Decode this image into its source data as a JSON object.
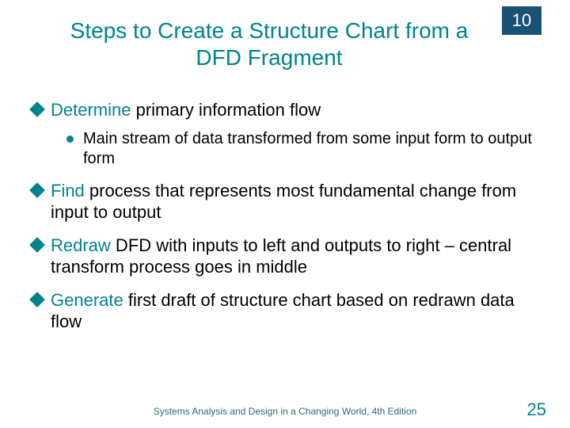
{
  "chapter": "10",
  "title": "Steps to Create a Structure Chart from a DFD Fragment",
  "bullets": [
    {
      "lead": "Determine",
      "rest": " primary information flow",
      "sub": [
        {
          "text": "Main stream of data transformed from some input form to output form"
        }
      ]
    },
    {
      "lead": "Find",
      "rest": " process that represents most fundamental change from input to output"
    },
    {
      "lead": "Redraw",
      "rest": " DFD with inputs to left and outputs to right – central transform process goes in middle"
    },
    {
      "lead": "Generate",
      "rest": " first draft of structure chart based on redrawn data flow"
    }
  ],
  "footer": "Systems Analysis and Design in a Changing World, 4th Edition",
  "page": "25"
}
